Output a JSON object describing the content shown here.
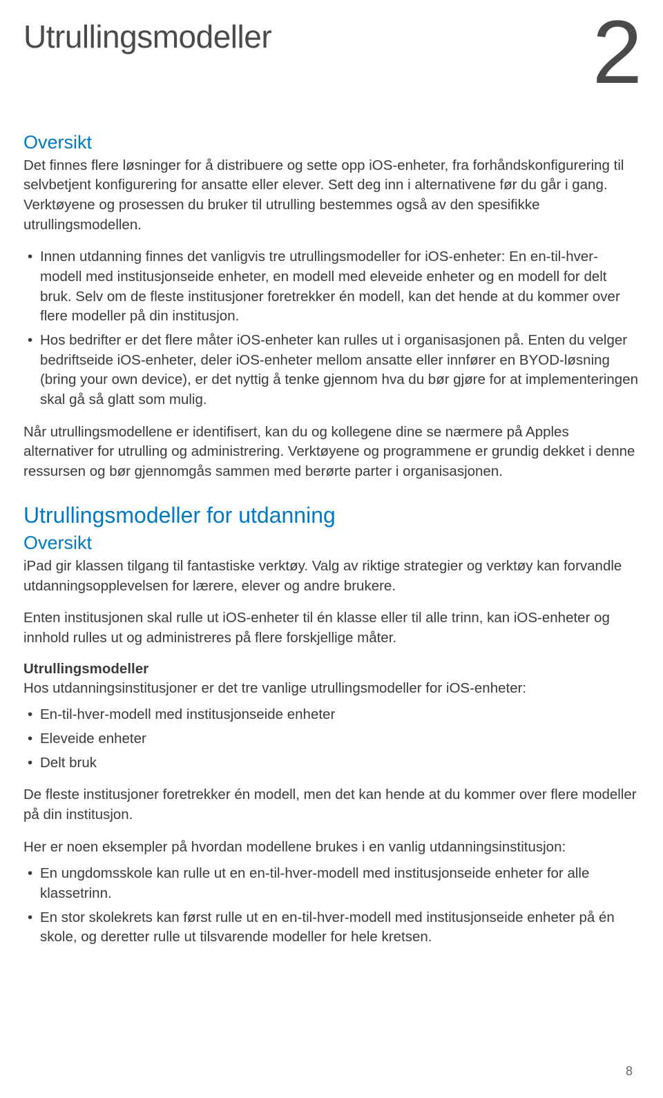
{
  "chapter": {
    "title": "Utrullingsmodeller",
    "number": "2"
  },
  "oversikt": {
    "heading": "Oversikt",
    "p1": "Det finnes flere løsninger for å distribuere og sette opp iOS-enheter, fra forhåndskonfigurering til selvbetjent konfigurering for ansatte eller elever. Sett deg inn i alternativene før du går i gang. Verktøyene og prosessen du bruker til utrulling bestemmes også av den spesifikke utrullingsmodellen.",
    "bullets": [
      "Innen utdanning finnes det vanligvis tre utrullingsmodeller for iOS-enheter: En en-til-hver-modell med institusjonseide enheter, en modell med eleveide enheter og en modell for delt bruk. Selv om de fleste institusjoner foretrekker én modell, kan det hende at du kommer over flere modeller på din institusjon.",
      "Hos bedrifter er det flere måter iOS-enheter kan rulles ut i organisasjonen på. Enten du velger bedriftseide iOS-enheter, deler iOS-enheter mellom ansatte eller innfører en BYOD-løsning (bring your own device), er det nyttig å tenke gjennom hva du bør gjøre for at implementeringen skal gå så glatt som mulig."
    ],
    "p2": "Når utrullingsmodellene er identifisert, kan du og kollegene dine se nærmere på Apples alternativer for utrulling og administrering. Verktøyene og programmene er grundig dekket i denne ressursen og bør gjennomgås sammen med berørte parter i organisasjonen."
  },
  "utdanning": {
    "heading": "Utrullingsmodeller for utdanning",
    "sub": "Oversikt",
    "p1": "iPad gir klassen tilgang til fantastiske verktøy. Valg av riktige strategier og verktøy kan forvandle utdanningsopplevelsen for lærere, elever og andre brukere.",
    "p2": "Enten institusjonen skal rulle ut iOS-enheter til én klasse eller til alle trinn, kan iOS-enheter og innhold rulles ut og administreres på flere forskjellige måter.",
    "modellerHeading": "Utrullingsmodeller",
    "p3": "Hos utdanningsinstitusjoner er det tre vanlige utrullingsmodeller for iOS-enheter:",
    "modelList": [
      "En-til-hver-modell med institusjonseide enheter",
      "Eleveide enheter",
      "Delt bruk"
    ],
    "p4": "De fleste institusjoner foretrekker én modell, men det kan hende at du kommer over flere modeller på din institusjon.",
    "p5": "Her er noen eksempler på hvordan modellene brukes i en vanlig utdanningsinstitusjon:",
    "examples": [
      "En ungdomsskole kan rulle ut en en-til-hver-modell med institusjonseide enheter for alle klassetrinn.",
      "En stor skolekrets kan først rulle ut en en-til-hver-modell med institusjonseide enheter på én skole, og deretter rulle ut tilsvarende modeller for hele kretsen."
    ]
  },
  "pageNumber": "8"
}
